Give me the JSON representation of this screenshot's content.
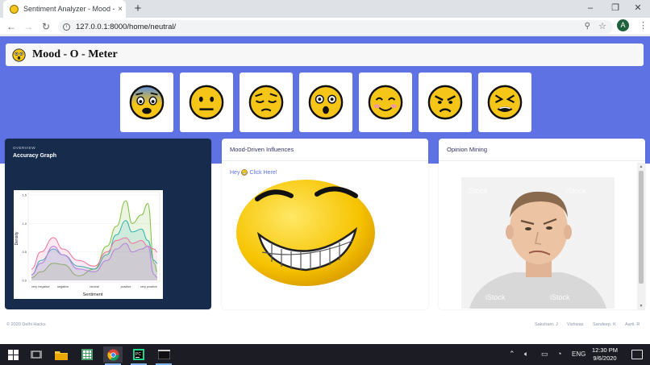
{
  "browser": {
    "tab_title": "Sentiment Analyzer - Mood - O",
    "tab_close": "×",
    "new_tab": "+",
    "url": "127.0.0.1:8000/home/neutral/",
    "profile_initial": "A",
    "window_controls": {
      "minimize": "–",
      "restore": "❐",
      "close": "✕"
    }
  },
  "page": {
    "brand": "Mood - O - Meter",
    "moods": [
      {
        "icon": "fearful-face-icon"
      },
      {
        "icon": "neutral-face-icon"
      },
      {
        "icon": "pensive-face-icon"
      },
      {
        "icon": "astonished-face-icon"
      },
      {
        "icon": "smiling-face-icon"
      },
      {
        "icon": "angry-face-icon"
      },
      {
        "icon": "tired-face-icon"
      }
    ],
    "cards": {
      "accuracy": {
        "overline": "OVERVIEW",
        "title": "Accuracy Graph"
      },
      "influences": {
        "title": "Mood-Driven Influences",
        "hey": "Hey",
        "click": "Click Here!"
      },
      "opinion": {
        "title": "Opinion Mining",
        "watermark": "iStock"
      }
    },
    "footer": {
      "copyright": "© 2020 Delhi Hacks",
      "credits": [
        "Saksham. J",
        "Vishwas",
        "Sandeep. K",
        "Aarti. R"
      ]
    }
  },
  "chart_data": {
    "type": "area",
    "xlabel": "Sentiment",
    "ylabel": "Density",
    "categories": [
      "very negative",
      "negative",
      "neutral",
      "positive",
      "very positive"
    ],
    "yticks": [
      "0.0",
      "0.5",
      "1.0",
      "1.5"
    ],
    "ylim": [
      0,
      1.5
    ],
    "series": [
      {
        "color": "#7fbf3f",
        "values": [
          [
            0,
            0.05
          ],
          [
            0.3,
            0.15
          ],
          [
            0.7,
            0.3
          ],
          [
            1,
            0.28
          ],
          [
            1.5,
            0.08
          ],
          [
            2,
            0.2
          ],
          [
            2.4,
            0.6
          ],
          [
            2.7,
            0.95
          ],
          [
            3,
            1.4
          ],
          [
            3.2,
            1.0
          ],
          [
            3.5,
            1.15
          ],
          [
            3.7,
            1.35
          ],
          [
            3.9,
            0.3
          ],
          [
            4,
            0.15
          ]
        ]
      },
      {
        "color": "#2bb3b3",
        "values": [
          [
            0,
            0.1
          ],
          [
            0.3,
            0.35
          ],
          [
            0.7,
            0.55
          ],
          [
            1,
            0.45
          ],
          [
            1.5,
            0.25
          ],
          [
            2,
            0.2
          ],
          [
            2.4,
            0.45
          ],
          [
            2.7,
            0.8
          ],
          [
            3,
            1.05
          ],
          [
            3.2,
            0.85
          ],
          [
            3.5,
            0.9
          ],
          [
            3.7,
            0.7
          ],
          [
            3.9,
            0.35
          ],
          [
            4,
            0.3
          ]
        ]
      },
      {
        "color": "#f06fa0",
        "values": [
          [
            0,
            0.2
          ],
          [
            0.3,
            0.5
          ],
          [
            0.7,
            0.75
          ],
          [
            1,
            0.55
          ],
          [
            1.5,
            0.35
          ],
          [
            2,
            0.25
          ],
          [
            2.4,
            0.5
          ],
          [
            2.7,
            0.7
          ],
          [
            3,
            0.75
          ],
          [
            3.2,
            0.65
          ],
          [
            3.5,
            0.7
          ],
          [
            3.7,
            0.6
          ],
          [
            3.9,
            0.55
          ],
          [
            4,
            0.5
          ]
        ]
      },
      {
        "color": "#b77fe0",
        "values": [
          [
            0,
            0.1
          ],
          [
            0.3,
            0.3
          ],
          [
            0.7,
            0.6
          ],
          [
            1,
            0.45
          ],
          [
            1.5,
            0.2
          ],
          [
            2,
            0.15
          ],
          [
            2.4,
            0.35
          ],
          [
            2.7,
            0.55
          ],
          [
            3,
            0.65
          ],
          [
            3.2,
            0.5
          ],
          [
            3.5,
            0.55
          ],
          [
            3.7,
            0.6
          ],
          [
            3.9,
            0.1
          ],
          [
            4,
            0.05
          ]
        ]
      }
    ]
  },
  "taskbar": {
    "lang": "ENG",
    "time": "12:30 PM",
    "date": "9/6/2020"
  }
}
